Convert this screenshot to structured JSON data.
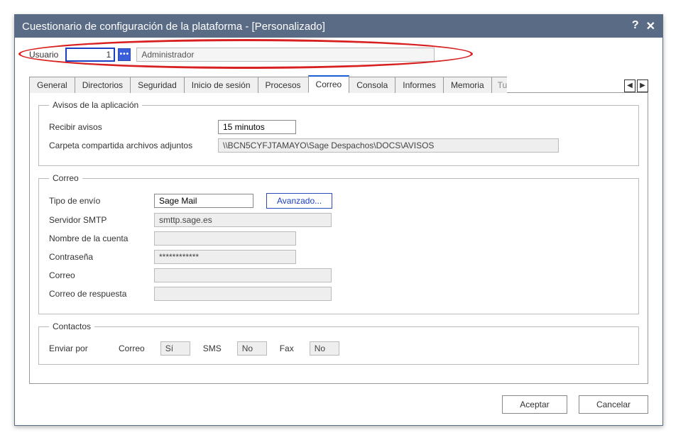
{
  "title": "Cuestionario de configuración de la plataforma - [Personalizado]",
  "help_icon": "?",
  "close_icon": "✕",
  "user": {
    "label": "Usuario",
    "id": "1",
    "lookup_icon": "•••",
    "name": "Administrador"
  },
  "tabs": {
    "general": "General",
    "directorios": "Directorios",
    "seguridad": "Seguridad",
    "inicio_sesion": "Inicio de sesión",
    "procesos": "Procesos",
    "correo": "Correo",
    "consola": "Consola",
    "informes": "Informes",
    "memoria": "Memoria",
    "partial": "Tu",
    "nav_left": "◀",
    "nav_right": "▶"
  },
  "avisos": {
    "legend": "Avisos de la aplicación",
    "recibir_label": "Recibir avisos",
    "recibir_value": "15 minutos",
    "carpeta_label": "Carpeta compartida archivos adjuntos",
    "carpeta_value": "\\\\BCN5CYFJTAMAYO\\Sage Despachos\\DOCS\\AVISOS"
  },
  "correo": {
    "legend": "Correo",
    "tipo_label": "Tipo de envío",
    "tipo_value": "Sage Mail",
    "avanzado": "Avanzado...",
    "smtp_label": "Servidor SMTP",
    "smtp_value": "smttp.sage.es",
    "cuenta_label": "Nombre de la cuenta",
    "cuenta_value": "",
    "pass_label": "Contraseña",
    "pass_value": "************",
    "correo_label": "Correo",
    "correo_value": "",
    "respuesta_label": "Correo de respuesta",
    "respuesta_value": ""
  },
  "contactos": {
    "legend": "Contactos",
    "enviar_por": "Enviar por",
    "correo_label": "Correo",
    "correo_value": "Sí",
    "sms_label": "SMS",
    "sms_value": "No",
    "fax_label": "Fax",
    "fax_value": "No"
  },
  "buttons": {
    "aceptar": "Aceptar",
    "cancelar": "Cancelar"
  }
}
